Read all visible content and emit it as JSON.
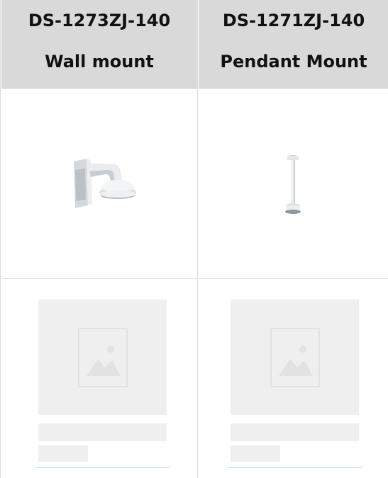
{
  "products": [
    {
      "model": "DS-1273ZJ-140",
      "mount_type": "Wall mount",
      "image_icon": "wall-mount-bracket",
      "placeholder_icon": "image-placeholder-icon"
    },
    {
      "model": "DS-1271ZJ-140",
      "mount_type": "Pendant Mount",
      "image_icon": "pendant-mount-pole",
      "placeholder_icon": "image-placeholder-icon"
    }
  ],
  "colors": {
    "header_bg": "#d9d9d9",
    "border": "#dcdcdc",
    "placeholder": "#efefef",
    "link_underline": "#b9d6f2"
  }
}
